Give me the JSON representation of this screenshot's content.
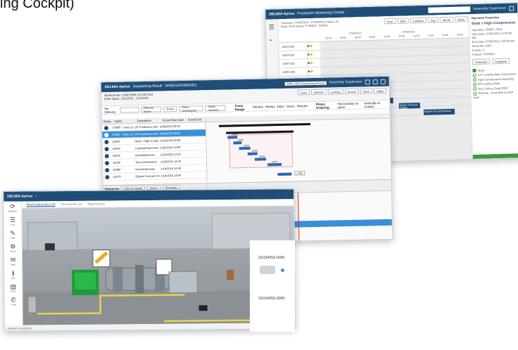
{
  "caption": "ing Cockpit)",
  "cockpit": {
    "title": "Production Monitoring Cockpit",
    "app": "DELMIA Apriso",
    "user": "Assembly Supervisor",
    "filter_line1": "Timespan: 07/05/2015 - 07/08/2015   Status: All",
    "filter_line2": "Shop: All   Products: PTR0007, 050001",
    "view_buttons": [
      "Hour",
      "Shift",
      "Collapse",
      "Day",
      "Month",
      "Week",
      "Year"
    ],
    "dates": [
      "07/08/2015",
      "07/09/2015"
    ],
    "times": [
      "00:00",
      "03:00",
      "06:00",
      "09:00",
      "12:00",
      "15:00",
      "18:00",
      "21:00",
      "00:00",
      "03:00"
    ],
    "rows": [
      "ASSY100",
      "ASSY101",
      "ASSY102",
      "ASSY103",
      "ASSY104",
      "ASSY105",
      "W1",
      "W1002",
      "W1003"
    ],
    "bars": [
      "Shaft + High Compression",
      "Tow",
      "Engine Fuel and Outlets",
      "Engine Fuel and Outlets"
    ],
    "props": {
      "header": "Operation Properties",
      "title": "Shaft + High Compression",
      "lines": [
        "Operation: 20080 - 0010",
        "Start Date: 07/09/2015 12:00:00 AM",
        "End Date: 07/09/2015 4:30:00 AM",
        "Serial No: 5002",
        "Priority: 3",
        "Product: PTR0007"
      ],
      "actions": [
        "Schedule",
        "Complete"
      ],
      "steps": [
        "Shaft",
        "H.P. Loading High Compressor",
        "High Compression Assembly",
        "BF Loading Shaft",
        "Tow Turbine Shaft 2020",
        "Release - Assembly to shaft prod"
      ]
    }
  },
  "dispatch": {
    "app": "DELMIA Apriso",
    "title": "Dispatching Result",
    "doc": "DR&DS2015093001",
    "user": "Assembly Supervisor",
    "search_value": "DPR_ASK Dispatching Result",
    "sub1": "Workcenter: LINE/Shift 1/4 2/5 8x3",
    "sub2": "Date Span: 1/1/2016 - 1/1/2016",
    "filter_label": "No Delivery",
    "toolbar": [
      "Filter by Name",
      "Reset",
      "Show Unassigned",
      "Show Unused"
    ],
    "group_label": "Timer Range",
    "group_options": [
      "Months",
      "Weeks",
      "Days",
      "Hours",
      "Minutes"
    ],
    "phase_label": "Phase Ordering",
    "phase_options": [
      "Horizontally on same",
      "Vertically to Screen"
    ],
    "actions": [
      "Load",
      "Refresh",
      "Locking",
      "Accept",
      "Save",
      "Apply"
    ],
    "columns": [
      "Status",
      "Name",
      "Description",
      "Sched Start Date",
      "Sched End"
    ],
    "rows": [
      [
        "T-0000 - Tube Line",
        "DS Production Item",
        "1/08/2016 00:00"
      ],
      [
        "20330 - Tube Line",
        "DS Production Item",
        "1/08/2016 00:00"
      ],
      [
        "10200",
        "Shaft - High Compress",
        "1/18/2016 09:00"
      ],
      [
        "10230",
        "Loading/Inspection",
        "1/18/2016 10:00"
      ],
      [
        "10240",
        "Assembly/Lines",
        "1/18/2016 12:00"
      ],
      [
        "10250",
        "Tow and Rotation",
        "1/18/2016 14:00"
      ],
      [
        "10260",
        "Assembly/Lines",
        "1/18/2016 16:00"
      ],
      [
        "10270",
        "Engine Fuel and Out",
        "1/18/2016 18:00"
      ]
    ],
    "bar_labels": [
      "10200",
      "10230",
      "10240",
      "10250",
      "10260",
      "10270"
    ],
    "zoom_label": "1 day",
    "resources_label": "Resources",
    "res_toolbar": [
      "Filter by Name",
      "Reset",
      "Schedule",
      "Find Order",
      "Suppress"
    ],
    "res_columns": [
      "Resource",
      "Name",
      "Work Center",
      "Info"
    ],
    "res_rows": [
      "100000",
      "100001",
      "100002",
      "100003",
      "100004",
      "100005",
      "100006",
      "100007",
      "100008",
      "100009"
    ]
  },
  "work": {
    "app": "DELMIA Apriso",
    "tabs": [
      "Work Instructions (3)",
      "Documents (2)",
      "Attachments"
    ],
    "side": [
      {
        "glyph": "⟳",
        "label": "Refresh"
      },
      {
        "glyph": "☰",
        "label": "List"
      },
      {
        "glyph": "✎",
        "label": "Edit"
      },
      {
        "glyph": "⚙",
        "label": "Tools"
      },
      {
        "glyph": "✉",
        "label": "Mail"
      },
      {
        "glyph": "ℹ",
        "label": "Info"
      },
      {
        "glyph": "▤",
        "label": "Docs"
      },
      {
        "glyph": "✆",
        "label": "Chat"
      }
    ],
    "status": "Feature is selected",
    "codes": [
      "SS1940SS-0000",
      "SS1940SS-0000"
    ]
  },
  "colors": {
    "brand": "#1f4e79",
    "selection": "#3a8fd6",
    "bar": "#2f67b2",
    "accent_orange": "#e08a24",
    "ok_green": "#3c9a3c"
  }
}
